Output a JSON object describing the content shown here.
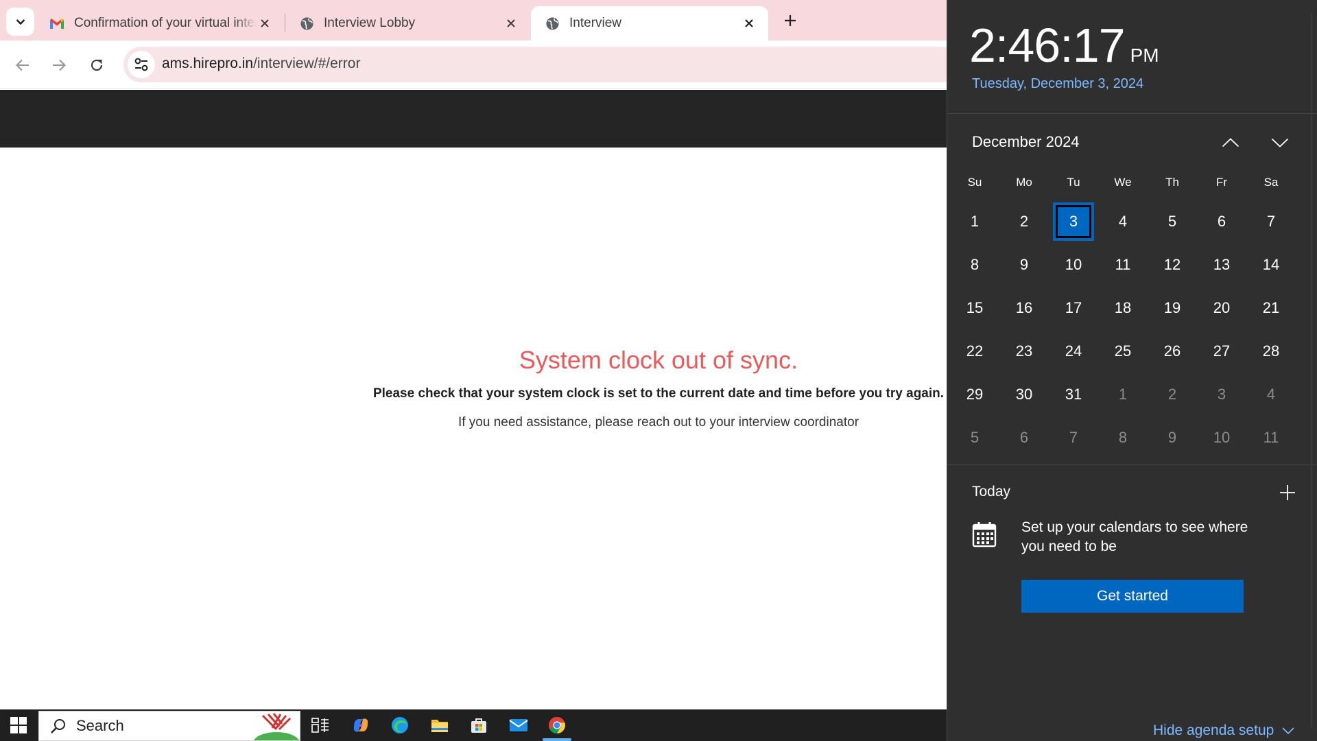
{
  "browser": {
    "tabs": [
      {
        "title": "Confirmation of your virtual interview",
        "icon": "gmail-icon",
        "active": false
      },
      {
        "title": "Interview Lobby",
        "icon": "globe-icon",
        "active": false
      },
      {
        "title": "Interview",
        "icon": "globe-icon",
        "active": true
      }
    ],
    "url": {
      "host": "ams.hirepro.in",
      "path": "/interview/#/error"
    }
  },
  "page": {
    "error_title": "System clock out of sync.",
    "error_message": "Please check that your system clock is set to the current date and time before you try again.",
    "help_text": "If you need assistance, please reach out to your interview coordinator"
  },
  "taskbar": {
    "search_label": "Search",
    "pinned_icons": [
      "task-view-icon",
      "copilot-icon",
      "edge-icon",
      "file-explorer-icon",
      "store-icon",
      "mail-icon",
      "chrome-icon"
    ],
    "active_app": "chrome-icon"
  },
  "calendar": {
    "time": "2:46:17",
    "ampm": "PM",
    "date_long": "Tuesday, December 3, 2024",
    "month_label": "December 2024",
    "weekdays": [
      "Su",
      "Mo",
      "Tu",
      "We",
      "Th",
      "Fr",
      "Sa"
    ],
    "weeks": [
      [
        [
          "1",
          true
        ],
        [
          "2",
          true
        ],
        [
          "3",
          true
        ],
        [
          "4",
          true
        ],
        [
          "5",
          true
        ],
        [
          "6",
          true
        ],
        [
          "7",
          true
        ]
      ],
      [
        [
          "8",
          true
        ],
        [
          "9",
          true
        ],
        [
          "10",
          true
        ],
        [
          "11",
          true
        ],
        [
          "12",
          true
        ],
        [
          "13",
          true
        ],
        [
          "14",
          true
        ]
      ],
      [
        [
          "15",
          true
        ],
        [
          "16",
          true
        ],
        [
          "17",
          true
        ],
        [
          "18",
          true
        ],
        [
          "19",
          true
        ],
        [
          "20",
          true
        ],
        [
          "21",
          true
        ]
      ],
      [
        [
          "22",
          true
        ],
        [
          "23",
          true
        ],
        [
          "24",
          true
        ],
        [
          "25",
          true
        ],
        [
          "26",
          true
        ],
        [
          "27",
          true
        ],
        [
          "28",
          true
        ]
      ],
      [
        [
          "29",
          true
        ],
        [
          "30",
          true
        ],
        [
          "31",
          true
        ],
        [
          "1",
          false
        ],
        [
          "2",
          false
        ],
        [
          "3",
          false
        ],
        [
          "4",
          false
        ]
      ],
      [
        [
          "5",
          false
        ],
        [
          "6",
          false
        ],
        [
          "7",
          false
        ],
        [
          "8",
          false
        ],
        [
          "9",
          false
        ],
        [
          "10",
          false
        ],
        [
          "11",
          false
        ]
      ]
    ],
    "selected_day": "3",
    "agenda": {
      "today_label": "Today",
      "message": "Set up your calendars to see where you need to be",
      "button_label": "Get started",
      "hide_label": "Hide agenda setup"
    },
    "colors": {
      "accent": "#0067c0",
      "link": "#7cb8ff",
      "background": "#2f2f2f"
    }
  }
}
